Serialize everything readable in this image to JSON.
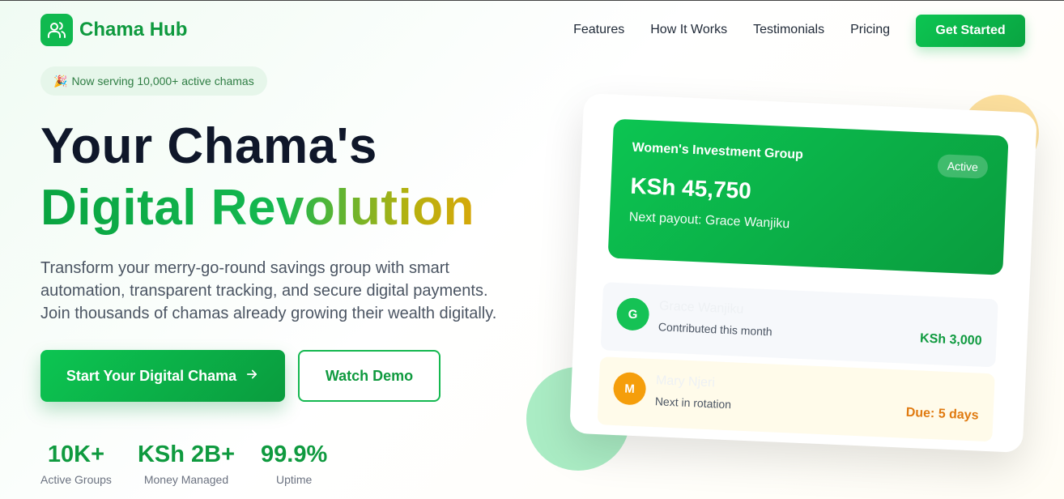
{
  "brand": {
    "name": "Chama Hub",
    "logo_icon": "users-icon"
  },
  "nav": {
    "links": [
      "Features",
      "How It Works",
      "Testimonials",
      "Pricing"
    ],
    "cta": "Get Started"
  },
  "badge": {
    "emoji": "🎉",
    "text": "Now serving 10,000+ active chamas"
  },
  "hero": {
    "title_line1": "Your Chama's",
    "title_line2": "Digital Revolution",
    "description": "Transform your merry-go-round savings group with smart automation, transparent tracking, and secure digital payments. Join thousands of chamas already growing their wealth digitally.",
    "primary_button": "Start Your Digital Chama",
    "secondary_button": "Watch Demo"
  },
  "stats": [
    {
      "value": "10K+",
      "label": "Active Groups"
    },
    {
      "value": "KSh 2B+",
      "label": "Money Managed"
    },
    {
      "value": "99.9%",
      "label": "Uptime"
    }
  ],
  "card": {
    "group_name": "Women's Investment Group",
    "status": "Active",
    "amount": "KSh 45,750",
    "next_payout": "Next payout: Grace Wanjiku",
    "members": [
      {
        "initial": "G",
        "name": "Grace Wanjiku",
        "sub": "Contributed this month",
        "amount": "KSh 3,000"
      },
      {
        "initial": "M",
        "name": "Mary Njeri",
        "sub": "Next in rotation",
        "amount": "Due: 5 days"
      }
    ]
  },
  "colors": {
    "brand_green": "#0f9a3f",
    "accent_gold": "#d6a80a"
  }
}
